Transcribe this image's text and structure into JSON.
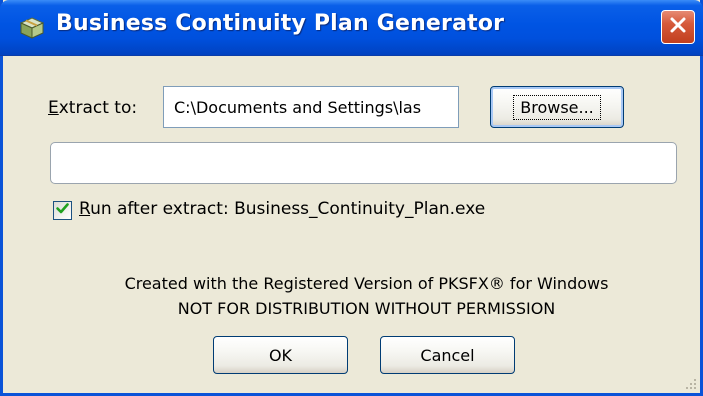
{
  "window": {
    "title": "Business Continuity Plan Generator",
    "app_icon": "package-icon",
    "close_icon": "close-icon"
  },
  "extract": {
    "label_mnemonic": "E",
    "label_rest": "xtract to:",
    "path_value": "C:\\Documents and Settings\\las",
    "browse_label": "Browse..."
  },
  "progress": {
    "fraction": 0.0
  },
  "run_after": {
    "checked": true,
    "label_mnemonic": "R",
    "label_rest": "un after extract: Business_Continuity_Plan.exe"
  },
  "notice": {
    "line1": "Created with the Registered Version of PKSFX® for Windows",
    "line2": "NOT FOR DISTRIBUTION WITHOUT PERMISSION"
  },
  "buttons": {
    "ok_label": "OK",
    "cancel_label": "Cancel"
  },
  "colors": {
    "titlebar": "#0054e3",
    "window_face": "#ece9d8",
    "close_button": "#d65a3b",
    "checkmark": "#21a121"
  }
}
